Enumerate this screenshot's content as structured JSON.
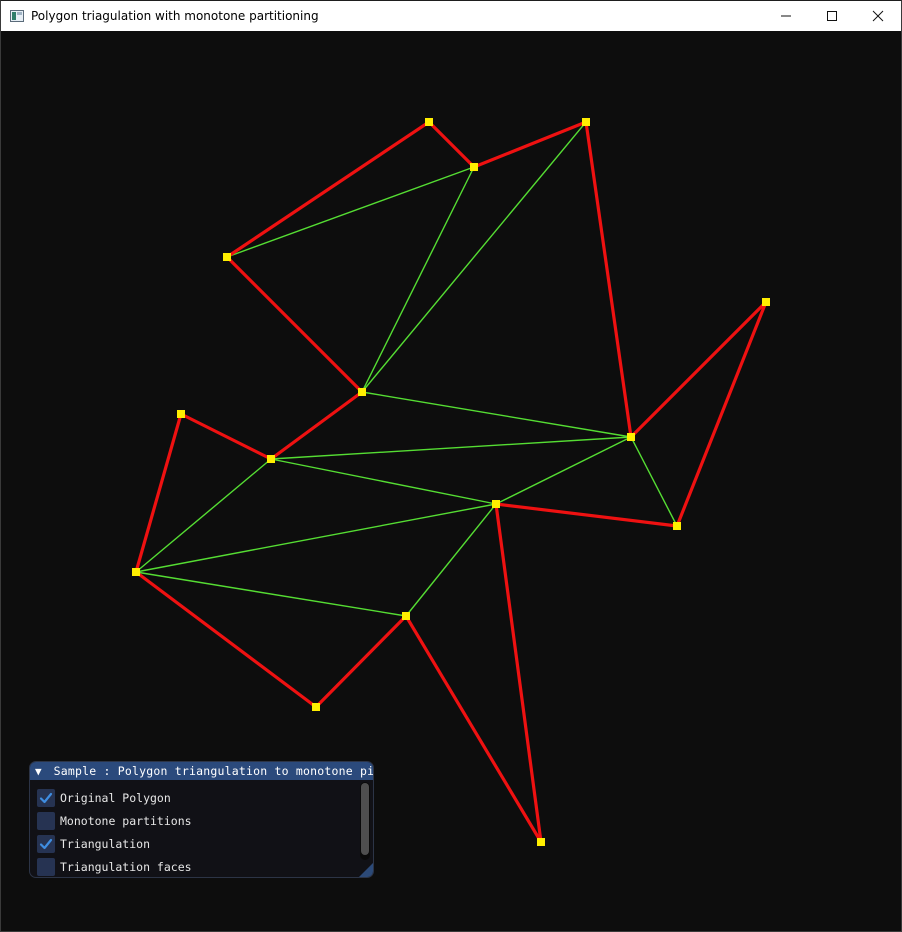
{
  "window": {
    "title": "Polygon triagulation with monotone partitioning",
    "controls": [
      "minimize",
      "maximize",
      "close"
    ]
  },
  "colors": {
    "background": "#0d0d0d",
    "polygon_edge": "#ee1111",
    "triangulation_edge": "#55dd33",
    "vertex": "#ffee00",
    "panel_header": "#2b4a7c",
    "checkbox": "#263352",
    "check": "#3f8de0"
  },
  "icons": {
    "app": "app-window-icon",
    "minimize": "minimize-icon",
    "maximize": "maximize-icon",
    "close": "close-icon",
    "collapse": "collapse-arrow-icon",
    "check": "checkmark-icon"
  },
  "panel": {
    "title": "Sample : Polygon triangulation to monotone pi",
    "collapse_glyph": "▼",
    "options": [
      {
        "label": "Original Polygon",
        "checked": true
      },
      {
        "label": "Monotone partitions",
        "checked": false
      },
      {
        "label": "Triangulation",
        "checked": true
      },
      {
        "label": "Triangulation faces",
        "checked": false
      }
    ]
  }
}
